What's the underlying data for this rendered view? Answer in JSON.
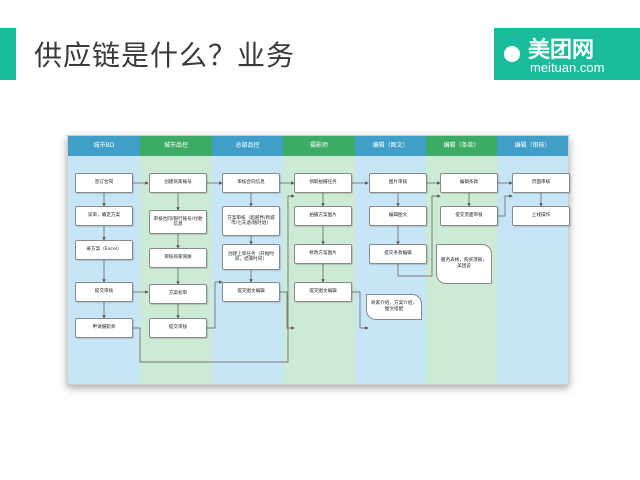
{
  "slide": {
    "title": "供应链是什么？业务"
  },
  "logo": {
    "main": "美团网",
    "sub": "meituan.com"
  },
  "colors": {
    "accent": "#1abc9c",
    "lane_blue": "#c6e6f5",
    "lane_green": "#cdebd4",
    "head_blue": "#3f9fc9",
    "head_green": "#3cab63"
  },
  "lanes": [
    {
      "label": "城市BD",
      "color": "blue"
    },
    {
      "label": "城市品控",
      "color": "green"
    },
    {
      "label": "总部品控",
      "color": "blue"
    },
    {
      "label": "摄影师",
      "color": "green"
    },
    {
      "label": "编辑（图文）",
      "color": "blue"
    },
    {
      "label": "编辑（条款）",
      "color": "green"
    },
    {
      "label": "编辑（审核）",
      "color": "blue"
    }
  ],
  "steps": {
    "bd": [
      "签订合同",
      "谈单，确定方案",
      "录方案（Excel）",
      "提交审核",
      "申请摄影师"
    ],
    "city_qc": [
      "创建商家账号",
      "审核合同/银行账号/付款信息",
      "审核商家资质",
      "方案初审",
      "提交审核"
    ],
    "hq_qc": [
      "审核合同信息",
      "方案审核（超越界/跨城市/七天退/随时退）",
      "创建上单任务（开始时间，结束时间）",
      "提交图文编辑"
    ],
    "photo": [
      "领取拍摄任务",
      "拍摄方案图片",
      "修改方案图片",
      "提交图文编辑"
    ],
    "edit_img": [
      "图片审核",
      "编辑图文",
      "提交条款编辑"
    ],
    "edit_img_note": "商家介绍，方案介绍，图文搭配",
    "edit_terms": [
      "编辑条款",
      "提交页面审核"
    ],
    "edit_terms_note": "服务表格，购买须知，美团说",
    "edit_review": [
      "页面审核",
      "上线操作"
    ]
  }
}
